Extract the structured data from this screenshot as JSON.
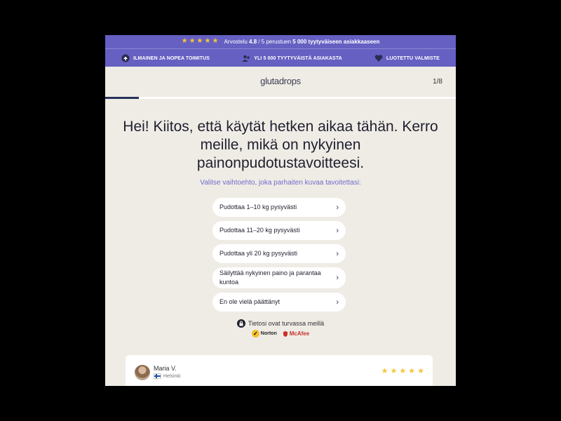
{
  "topbar": {
    "stars": [
      "★",
      "★",
      "★",
      "★",
      "★"
    ],
    "rating_prefix": "Arvostelu ",
    "rating_value": "4.8",
    "rating_mid": " / 5 perustuen ",
    "rating_count": "5 000 tyytyväiseen asiakkaaseen",
    "benefits": [
      {
        "label": "ILMAINEN JA NOPEA TOIMITUS",
        "icon": "delivery-icon"
      },
      {
        "label": "YLI 5 000 TYYTYVÄISTÄ ASIAKASTA",
        "icon": "users-icon"
      },
      {
        "label": "LUOTETTU VALMISTE",
        "icon": "heart-icon"
      }
    ],
    "star_color": "#f5c43c",
    "background": "#6560c2"
  },
  "header": {
    "logo": "glutadrops",
    "step": "1/8",
    "progress": 0.095
  },
  "main": {
    "headline": "Hei! Kiitos, että käytät hetken aikaa tähän. Kerro meille, mikä on nykyinen painonpudotustavoitteesi.",
    "subline": "Valitse vaihtoehto, joka parhaiten kuvaa tavoitettasi:",
    "options": [
      "Pudottaa 1–10 kg pysyvästi",
      "Pudottaa 11–20 kg pysyvästi",
      "Pudottaa yli 20 kg pysyvästi",
      "Säilyttää nykyinen paino ja parantaa kuntoa",
      "En ole vielä päättänyt"
    ],
    "option_chevron": "›"
  },
  "security": {
    "text": "Tietosi ovat turvassa meillä",
    "norton": "Norton",
    "mcafee": "McAfee"
  },
  "review": {
    "name": "Maria V.",
    "city": "Helsinki",
    "stars": [
      "★",
      "★",
      "★",
      "★",
      "★"
    ]
  }
}
